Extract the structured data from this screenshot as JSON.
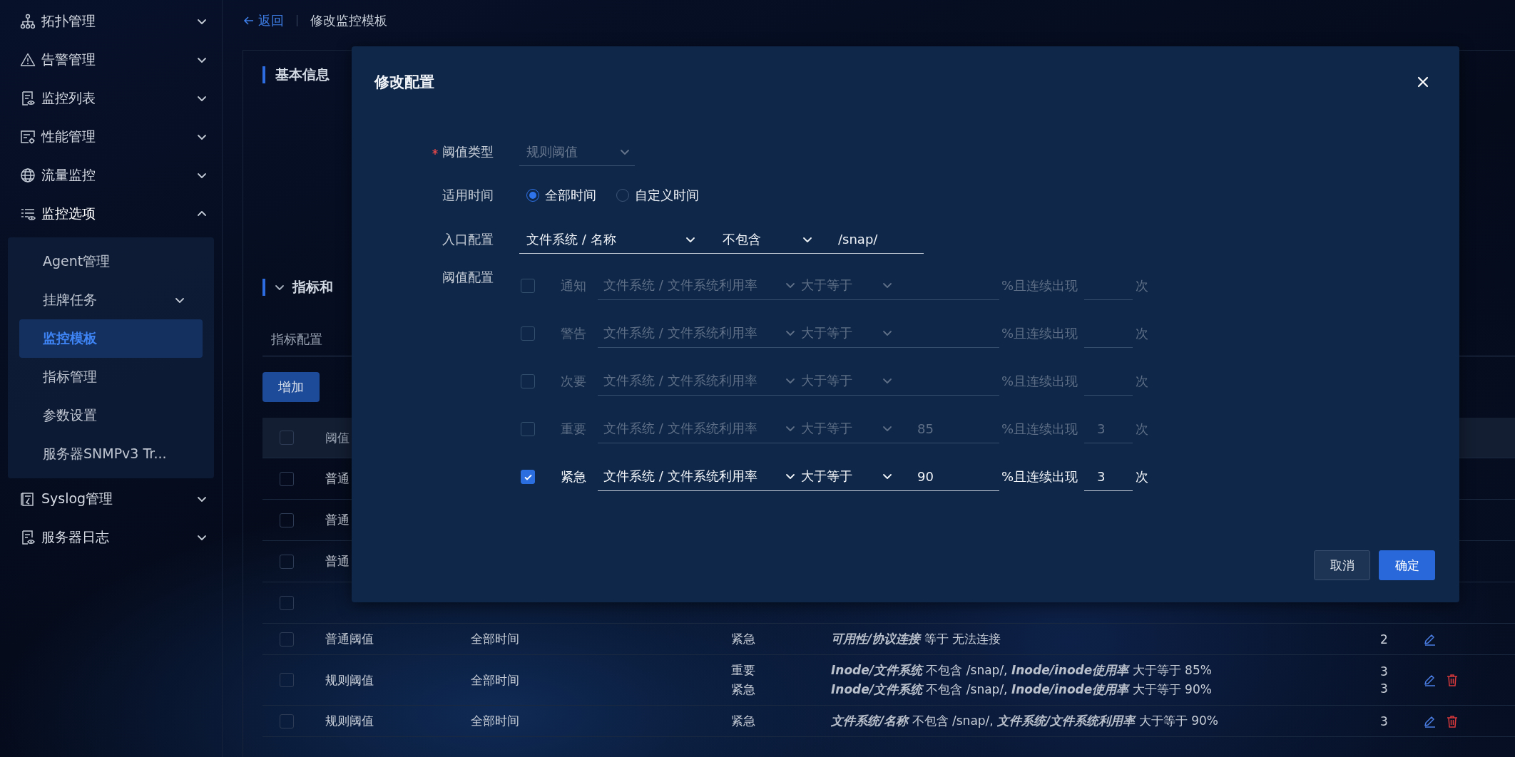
{
  "sidebar": {
    "items": [
      {
        "label": "拓扑管理",
        "expanded": false
      },
      {
        "label": "告警管理",
        "expanded": false
      },
      {
        "label": "监控列表",
        "expanded": false
      },
      {
        "label": "性能管理",
        "expanded": false
      },
      {
        "label": "流量监控",
        "expanded": false
      },
      {
        "label": "监控选项",
        "expanded": true,
        "children": [
          {
            "label": "Agent管理",
            "kind": "link",
            "selected": false
          },
          {
            "label": "挂牌任务",
            "kind": "group",
            "selected": false
          },
          {
            "label": "监控模板",
            "kind": "link",
            "selected": true
          },
          {
            "label": "指标管理",
            "kind": "link",
            "selected": false
          },
          {
            "label": "参数设置",
            "kind": "link",
            "selected": false
          },
          {
            "label": "服务器SNMPv3 Tr...",
            "kind": "link",
            "selected": false
          }
        ]
      },
      {
        "label": "Syslog管理",
        "expanded": false
      },
      {
        "label": "服务器日志",
        "expanded": false
      }
    ]
  },
  "breadcrumb": {
    "back": "返回",
    "title": "修改监控模板"
  },
  "basic_section": {
    "title": "基本信息"
  },
  "metrics_section": {
    "title": "指标和",
    "expanded": true
  },
  "tabs": [
    {
      "label": "指标配置",
      "selected": false
    }
  ],
  "toolbar": {
    "add": "增加"
  },
  "table": {
    "header_checked": false,
    "column_1": "阈值",
    "rows": [
      {
        "checked": false,
        "type": "普通"
      },
      {
        "checked": false,
        "type": "普通"
      },
      {
        "checked": false,
        "type": "普通"
      },
      {
        "checked": false
      },
      {
        "checked": false,
        "type": "普通阈值",
        "time": "全部时间",
        "levels": [
          "紧急"
        ],
        "conditions": [
          "**可用性/协议连接** 等于 无法连接"
        ],
        "counts": [
          "2"
        ],
        "deletable": false
      },
      {
        "checked": false,
        "type": "规则阈值",
        "time": "全部时间",
        "levels": [
          "重要",
          "紧急"
        ],
        "conditions": [
          "**Inode/文件系统** 不包含 /snap/, **Inode/inode使用率** 大于等于 85%",
          "**Inode/文件系统** 不包含 /snap/, **Inode/inode使用率** 大于等于 90%"
        ],
        "counts": [
          "3",
          "3"
        ],
        "deletable": true
      },
      {
        "checked": false,
        "type": "规则阈值",
        "time": "全部时间",
        "levels": [
          "紧急"
        ],
        "conditions": [
          "**文件系统/名称** 不包含 /snap/, **文件系统/文件系统利用率** 大于等于 90%"
        ],
        "counts": [
          "3"
        ],
        "deletable": true
      }
    ]
  },
  "dialog": {
    "title": "修改配置",
    "threshold_type": {
      "label": "阈值类型",
      "required": true,
      "value": "规则阈值",
      "disabled": true
    },
    "apply_time": {
      "label": "适用时间",
      "options": [
        {
          "label": "全部时间",
          "selected": true
        },
        {
          "label": "自定义时间",
          "selected": false
        }
      ]
    },
    "entry": {
      "label": "入口配置",
      "metric": "文件系统 / 名称",
      "operator": "不包含",
      "value": "/snap/"
    },
    "thresholds": {
      "label": "阈值配置",
      "rows": [
        {
          "level": "通知",
          "checked": false,
          "metric": "文件系统 / 文件系统利用率",
          "operator": "大于等于",
          "suffix": "%且连续出现",
          "unit": "次"
        },
        {
          "level": "警告",
          "checked": false,
          "metric": "文件系统 / 文件系统利用率",
          "operator": "大于等于",
          "suffix": "%且连续出现",
          "unit": "次"
        },
        {
          "level": "次要",
          "checked": false,
          "metric": "文件系统 / 文件系统利用率",
          "operator": "大于等于",
          "suffix": "%且连续出现",
          "unit": "次"
        },
        {
          "level": "重要",
          "checked": false,
          "metric": "文件系统 / 文件系统利用率",
          "operator": "大于等于",
          "value": "85",
          "suffix": "%且连续出现",
          "count": "3",
          "unit": "次"
        },
        {
          "level": "紧急",
          "checked": true,
          "metric": "文件系统 / 文件系统利用率",
          "operator": "大于等于",
          "value": "90",
          "suffix": "%且连续出现",
          "count": "3",
          "unit": "次"
        }
      ]
    },
    "buttons": [
      {
        "label": "取消",
        "kind": "secondary"
      },
      {
        "label": "确定",
        "kind": "primary"
      }
    ]
  }
}
